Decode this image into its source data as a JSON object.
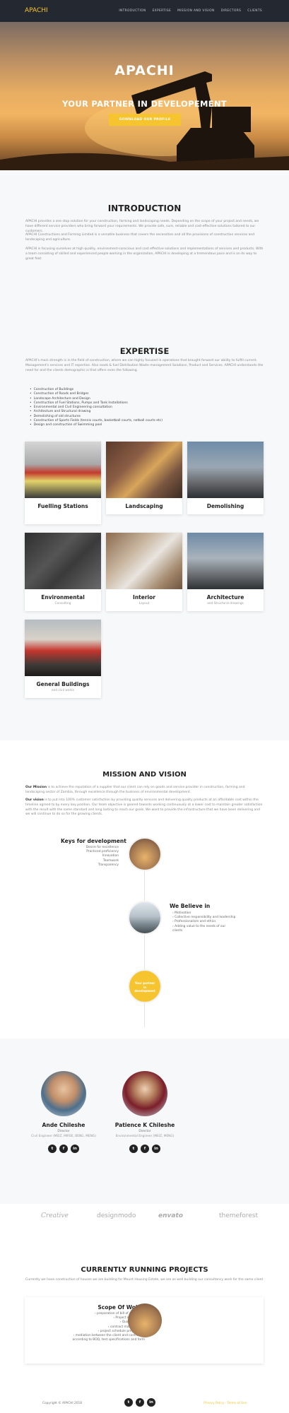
{
  "nav": {
    "brand": "APACHI",
    "links": [
      "INTRODUCTION",
      "EXPERTISE",
      "MISSION AND VISION",
      "DIRECTORS",
      "CLIENTS"
    ]
  },
  "hero": {
    "title": "APACHI",
    "subtitle": "YOUR PARTNER IN DEVELOPEMENT",
    "button": "DOWNLOAD OUR PROFILE"
  },
  "intro": {
    "title": "INTRODUCTION",
    "p1": "APACHI provides a one stop solution for your construction, farming and landscaping needs. Depending on the scope of your project and needs, we have different service providers who bring forward your requirements. We provide safe, sure, reliable and cost-effective solutions tailored to our customers.",
    "p2": "APACHI Constructions and Farming Limited is a versatile business that covers the necessities and all the provisions of construction services and landscaping and agriculture.",
    "p3": "APACHI is focusing ourselves at high quality, environment-conscious and cost effective solutions and implementations of services and products. With a team consisting of skilled and experienced people working in the organization, APACHI is developing at a tremendous pace and is on its way to great feat."
  },
  "expertise": {
    "title": "EXPERTISE",
    "intro": "APACHI's main strength is in the field of construction, where we can highly focused in operations that brought forward our ability to fulfill current. Management's services and IT expertise. Also roads & fuel Distribution Waste management Solutions, Product and Services. APACHI understands the need for and the clients demographic is that offers even the following.",
    "bullets": [
      "Construction of Buildings",
      "Construction of Roads and Bridges",
      "Landscape Architecture and Design",
      "Construction of Fuel Stations, Pumps and Tank Installations",
      "Environmental and Civil Engineering consultation",
      "Architecture and Structural drawing",
      "Demolishing of old structures",
      "Construction of Sports Fields (tennis courts, basketball courts, netball courts etc)",
      "Design and construction of Swimming pool"
    ],
    "cards": [
      {
        "title": "Fuelling Stations",
        "sub": ""
      },
      {
        "title": "Landscaping",
        "sub": ""
      },
      {
        "title": "Demolishing",
        "sub": ""
      },
      {
        "title": "Environmental",
        "sub": "Consulting"
      },
      {
        "title": "Interior",
        "sub": "Layout"
      },
      {
        "title": "Architecture",
        "sub": "and Structural drawings"
      },
      {
        "title": "General Buildings",
        "sub": "and civil works"
      }
    ]
  },
  "mission": {
    "title": "MISSION AND VISION",
    "mission_label": "Our Mission",
    "mission_text": "is to achieve the reputation of a supplier that our client can rely on goods and service provider in construction, farming and landscaping sector of Zambia, through excellence through the business of environmental development.",
    "vision_label": "Our vision",
    "vision_text": "is to put into 100% customer satisfaction by providing quality services and delivering quality products at an affordable cost within the timeline agreed to by every key position. Our team objective is geared towards working continuously at a lower cost to maintain greater satisfaction with the result with the same standard and long lasting to reach our goals. We want to provide the infrastructure that we have been delivering and we will continue to do so for the growing clients.",
    "keys_title": "Keys for development",
    "keys": [
      "Desire for excellence",
      "Practiced proficiency",
      "Innovation",
      "Teamwork",
      "Transparency"
    ],
    "believe_title": "We Believe in",
    "believe": [
      "Motivation",
      "Collective responsibility and leadership",
      "Professionalism and ethics",
      "Adding value to the needs of our clients"
    ],
    "badge": "Your partner in development"
  },
  "team": [
    {
      "name": "Ande Chileshe",
      "role": "Director",
      "desc": "Civil Engineer (MEIZ, MIRSE, BENG, MENG)"
    },
    {
      "name": "Patience K Chileshe",
      "role": "Director",
      "desc": "Environmental Engineer (MEIZ, MENG)"
    }
  ],
  "clients": [
    "Creative",
    "designmodo",
    "envato",
    "themeforest"
  ],
  "projects": {
    "title": "CURRENTLY RUNNING PROJECTS",
    "intro": "Currently we have construction of houses we are building for Mount Housing Estate, we are as well building our consultancy work for the same client",
    "scope_title": "Scope Of Wokrs",
    "scope_items": [
      "preparation of bill of quantities",
      "Project supervision",
      "Quality control",
      "contract management",
      "project schedule preparation",
      "mediation between the client and contractor according to BOQ, test specifications and form"
    ]
  },
  "footer": {
    "copyright": "Copyright © APACHI 2018",
    "right": "Privacy Policy · Terms of Use"
  }
}
